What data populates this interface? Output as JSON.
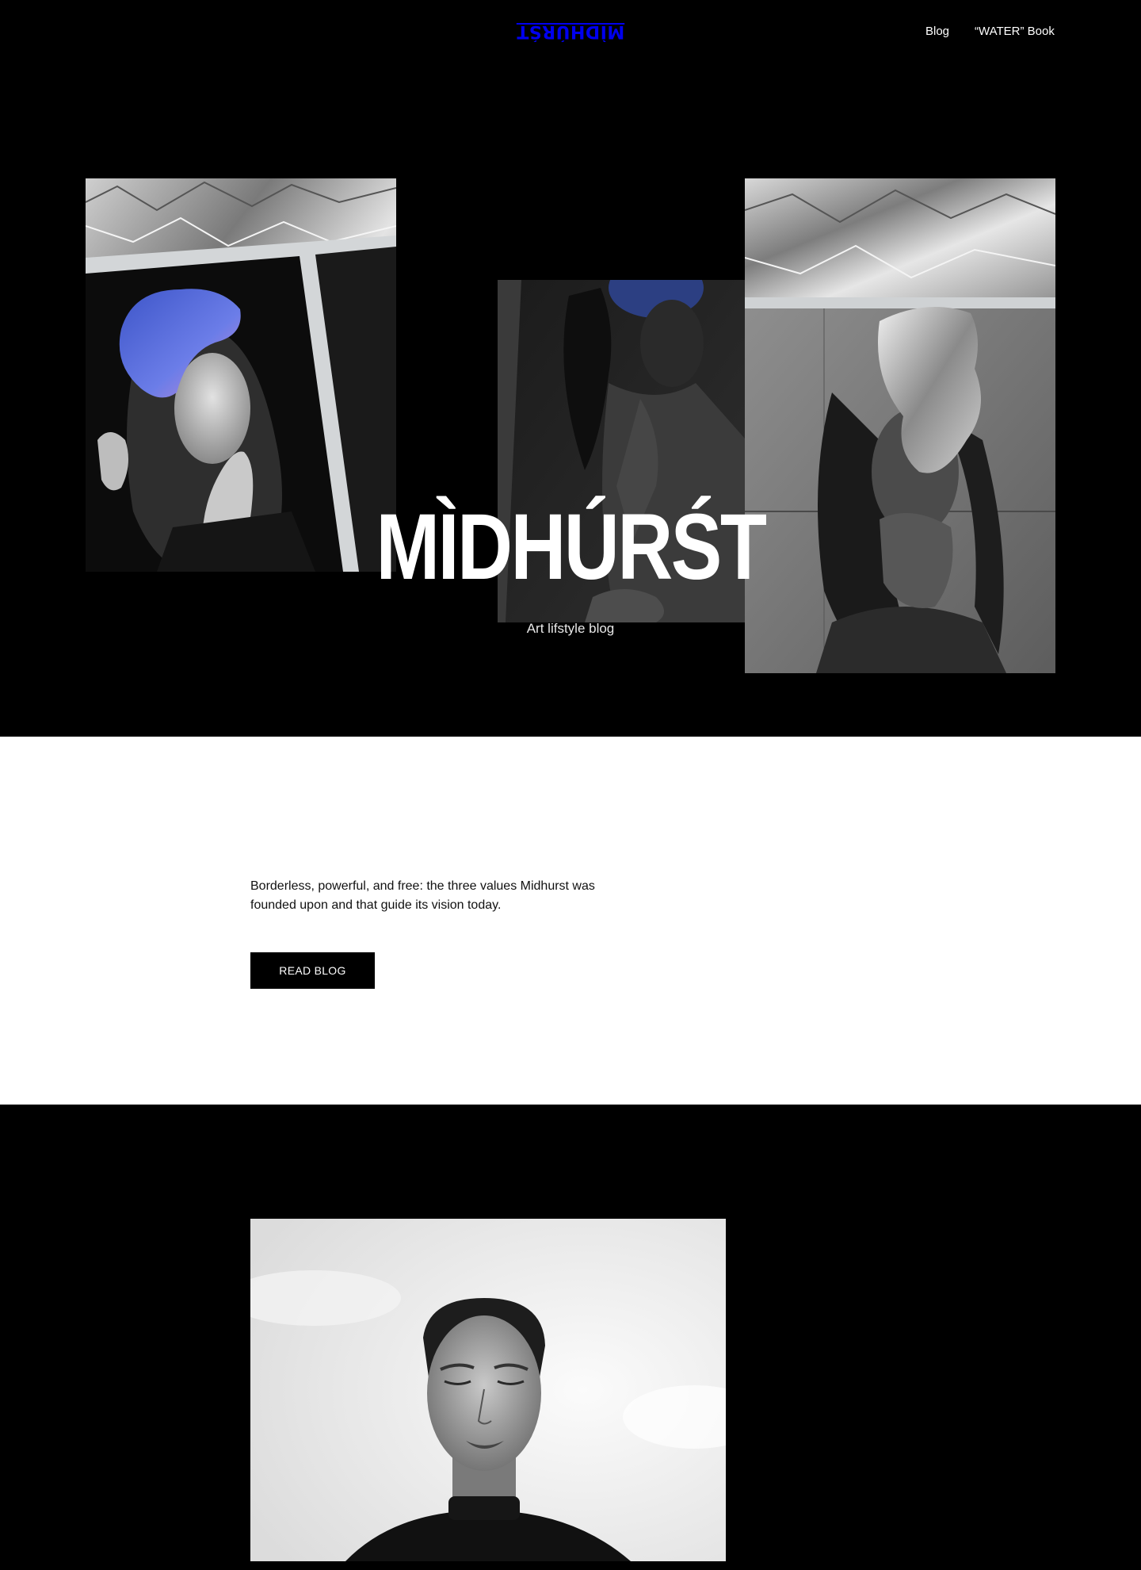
{
  "header": {
    "logo": "MÌDHÚRŚT",
    "nav": [
      {
        "label": "Blog"
      },
      {
        "label": "“WATER” Book"
      }
    ]
  },
  "hero": {
    "title": "MÌDHÚRŚT",
    "subtitle": "Art lifstyle blog",
    "images": [
      {
        "subject": "woman with blue-violet flower petal over eye, magazine page on crumpled foil"
      },
      {
        "subject": "dark editorial photo of woman with blue petal"
      },
      {
        "subject": "woman with crumpled foil covering face against concrete wall"
      }
    ]
  },
  "about": {
    "text": "Borderless, powerful, and free: the three values Midhurst was founded upon and that guide its vision today.",
    "button_label": "READ BLOG"
  },
  "feature": {
    "image": {
      "subject": "black and white portrait of woman with short hair, eyes closed, against sky"
    }
  },
  "colors": {
    "background_dark": "#000000",
    "background_light": "#ffffff",
    "text_light": "#ffffff",
    "text_dark": "#111111",
    "petal_accent": "#6a78e0"
  }
}
